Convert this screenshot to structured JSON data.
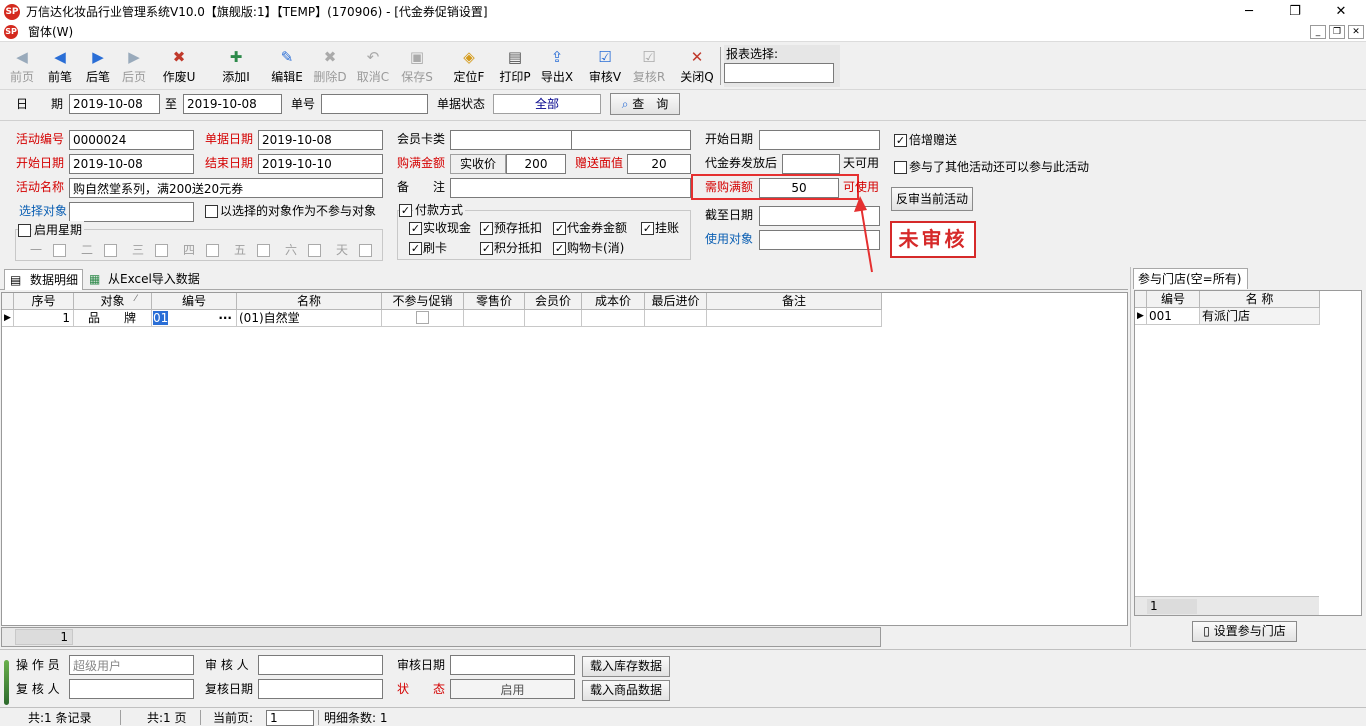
{
  "window": {
    "title": "万信达化妆品行业管理系统V10.0【旗舰版:1】【TEMP】(170906) - [代金券促销设置]",
    "logo_text": "SP",
    "minimize": "─",
    "restore": "❐",
    "close": "✕"
  },
  "menu": {
    "label": "窗体(W)",
    "mdi_min": "_",
    "mdi_restore": "❐",
    "mdi_close": "✕"
  },
  "toolbar": {
    "items": [
      {
        "label": "前页",
        "icon": "◀",
        "enabled": false,
        "color": "#9ab"
      },
      {
        "label": "前笔",
        "icon": "◀",
        "enabled": true,
        "color": "#2a6ed6"
      },
      {
        "label": "后笔",
        "icon": "▶",
        "enabled": true,
        "color": "#2a6ed6"
      },
      {
        "label": "后页",
        "icon": "▶",
        "enabled": false,
        "color": "#9ab"
      },
      {
        "label": "作废U",
        "icon": "✖",
        "enabled": true,
        "color": "#c0392b"
      },
      {
        "label": "添加I",
        "icon": "✚",
        "enabled": true,
        "color": "#2d8a4a"
      },
      {
        "label": "编辑E",
        "icon": "✎",
        "enabled": true,
        "color": "#2a6ed6"
      },
      {
        "label": "删除D",
        "icon": "✖",
        "enabled": false,
        "color": "#aaa"
      },
      {
        "label": "取消C",
        "icon": "↶",
        "enabled": false,
        "color": "#aaa"
      },
      {
        "label": "保存S",
        "icon": "▣",
        "enabled": false,
        "color": "#aaa"
      },
      {
        "label": "定位F",
        "icon": "◈",
        "enabled": true,
        "color": "#d49a1a"
      },
      {
        "label": "打印P",
        "icon": "▤",
        "enabled": true,
        "color": "#555"
      },
      {
        "label": "导出X",
        "icon": "⇪",
        "enabled": true,
        "color": "#2a6ed6"
      },
      {
        "label": "审核V",
        "icon": "☑",
        "enabled": true,
        "color": "#2a6ed6"
      },
      {
        "label": "复核R",
        "icon": "☑",
        "enabled": false,
        "color": "#aaa"
      },
      {
        "label": "关闭Q",
        "icon": "✕",
        "enabled": true,
        "color": "#c0392b"
      }
    ],
    "report_select_label": "报表选择:",
    "report_select_value": ""
  },
  "filter": {
    "date_label_1": "日",
    "date_label_2": "期",
    "date_from": "2019-10-08",
    "to_label": "至",
    "date_to": "2019-10-08",
    "doc_no_label": "单号",
    "doc_no": "",
    "status_label": "单据状态",
    "status_value": "全部",
    "query_button": "查　询",
    "query_icon": "⌕"
  },
  "form": {
    "activity_no_label": "活动编号",
    "activity_no": "0000024",
    "doc_date_label": "单据日期",
    "doc_date": "2019-10-08",
    "member_card_label": "会员卡类",
    "member_card": "",
    "member_card_2": "",
    "start_date_label": "开始日期",
    "start_date": "2019-10-08",
    "end_date_label": "结束日期",
    "end_date": "2019-10-10",
    "purchase_amount_label": "购满金额",
    "price_type": "实收价",
    "purchase_amount": "200",
    "gift_value_label": "赠送面值",
    "gift_value": "20",
    "activity_name_label": "活动名称",
    "activity_name": "购自然堂系列，满200送20元券",
    "remark_label_1": "备",
    "remark_label_2": "注",
    "remark": "",
    "select_target_label": "选择对象",
    "select_target": "",
    "exclude_selected_label": "以选择的对象作为不参与对象",
    "enable_weekday_label": "启用星期",
    "weekdays": [
      "一",
      "二",
      "三",
      "四",
      "五",
      "六",
      "天"
    ],
    "payment_method_label": "付款方式",
    "payments": [
      {
        "label": "实收现金",
        "checked": true
      },
      {
        "label": "预存抵扣",
        "checked": true
      },
      {
        "label": "代金券金额",
        "checked": true
      },
      {
        "label": "挂账",
        "checked": true
      },
      {
        "label": "刷卡",
        "checked": true
      },
      {
        "label": "积分抵扣",
        "checked": true
      },
      {
        "label": "购物卡(消)",
        "checked": true
      }
    ],
    "right_start_date_label": "开始日期",
    "right_start_date": "",
    "voucher_issue_label": "代金券发放后",
    "voucher_issue_days": "",
    "days_usable_label": "天可用",
    "required_purchase_label": "需购满额",
    "required_purchase": "50",
    "usable_label": "可使用",
    "deadline_label": "截至日期",
    "deadline": "",
    "use_target_label": "使用对象",
    "use_target": "",
    "double_gift_label": "倍增赠送",
    "double_gift_checked": true,
    "other_activity_label": "参与了其他活动还可以参与此活动",
    "other_activity_checked": false,
    "unaudit_button": "反审当前活动",
    "stamp": "未审核",
    "check_mark": "✓"
  },
  "tabs": [
    {
      "label": "数据明细",
      "icon": "▤"
    },
    {
      "label": "从Excel导入数据",
      "icon": "▦"
    }
  ],
  "grid": {
    "columns": [
      "序号",
      "对象",
      "编号",
      "名称",
      "不参与促销",
      "零售价",
      "会员价",
      "成本价",
      "最后进价",
      "备注"
    ],
    "sort_mark": "⁄",
    "ellipsis": "···",
    "row_marker": "▶",
    "rows": [
      {
        "seq": "1",
        "target": "品　　牌",
        "code": "01",
        "name": "(01)自然堂",
        "excluded": false,
        "retail": "",
        "member": "",
        "cost": "",
        "last_in": "",
        "remark": ""
      }
    ],
    "footer_count": "1"
  },
  "stores": {
    "title": "参与门店(空=所有)",
    "columns": [
      "编号",
      "名 称"
    ],
    "row_marker": "▶",
    "rows": [
      {
        "code": "001",
        "name": "有派门店"
      }
    ],
    "footer_count": "1",
    "set_button": "设置参与门店",
    "set_button_icon": "▯"
  },
  "bottom": {
    "operator_label": "操 作 员",
    "operator": "超级用户",
    "auditor_label": "审 核 人",
    "auditor": "",
    "audit_date_label": "审核日期",
    "audit_date": "",
    "load_stock_button": "载入库存数据",
    "reviewer_label": "复 核 人",
    "reviewer": "",
    "review_date_label": "复核日期",
    "review_date": "",
    "state_label_1": "状",
    "state_label_2": "态",
    "state": "启用",
    "load_goods_button": "载入商品数据"
  },
  "status": {
    "records": "共:1 条记录",
    "pages": "共:1 页",
    "current_page_label": "当前页:",
    "current_page": "1",
    "detail_count": "明细条数:  1"
  }
}
